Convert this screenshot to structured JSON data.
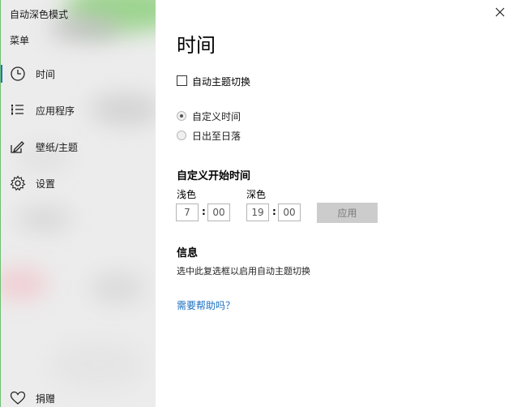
{
  "app": {
    "title": "自动深色模式"
  },
  "sidebar": {
    "menu_label": "菜单",
    "items": [
      {
        "label": "时间",
        "icon": "clock-icon"
      },
      {
        "label": "应用程序",
        "icon": "list-icon"
      },
      {
        "label": "壁纸/主题",
        "icon": "edit-icon"
      },
      {
        "label": "设置",
        "icon": "gear-icon"
      }
    ],
    "donate": {
      "label": "捐赠",
      "icon": "heart-icon"
    }
  },
  "main": {
    "title": "时间",
    "auto_switch_label": "自动主题切换",
    "auto_switch_checked": false,
    "radio_options": [
      {
        "label": "自定义时间",
        "checked": true
      },
      {
        "label": "日出至日落",
        "checked": false
      }
    ],
    "custom_time": {
      "title": "自定义开始时间",
      "light": {
        "label": "浅色",
        "hour": "7",
        "minute": "00"
      },
      "dark": {
        "label": "深色",
        "hour": "19",
        "minute": "00"
      },
      "separator": ":",
      "apply_label": "应用"
    },
    "info": {
      "title": "信息",
      "text": "选中此复选框以启用自动主题切换"
    },
    "help_link": "需要帮助吗？"
  },
  "colors": {
    "accent": "#1a73c8",
    "link": "#1a6fc0",
    "disabled_button": "#cccccc"
  }
}
